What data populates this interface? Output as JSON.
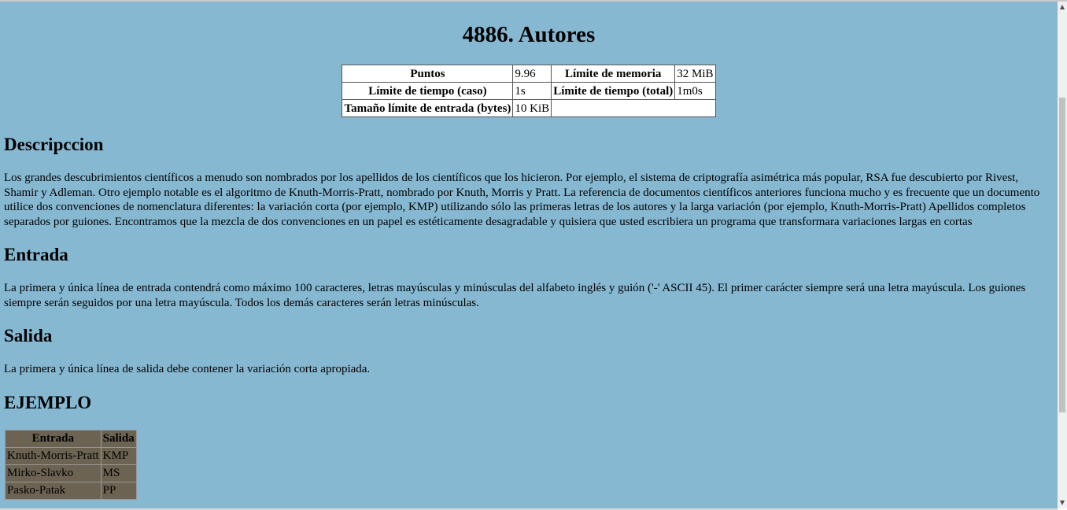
{
  "title": "4886. Autores",
  "info_table": {
    "puntos_label": "Puntos",
    "puntos_value": "9.96",
    "memoria_label": "Límite de memoria",
    "memoria_value": "32 MiB",
    "tiempo_caso_label": "Límite de tiempo (caso)",
    "tiempo_caso_value": "1s",
    "tiempo_total_label": "Límite de tiempo (total)",
    "tiempo_total_value": "1m0s",
    "entrada_label": "Tamaño límite de entrada (bytes)",
    "entrada_value": "10 KiB"
  },
  "sections": {
    "descripcion_heading": "Descripccion",
    "descripcion_text": "Los grandes descubrimientos científicos a menudo son nombrados por los apellidos de los científicos que los hicieron. Por ejemplo, el sistema de criptografía asimétrica más popular, RSA fue descubierto por Rivest, Shamir y Adleman. Otro ejemplo notable es el algoritmo de Knuth-Morris-Pratt, nombrado por Knuth, Morris y Pratt. La referencia de documentos científicos anteriores funciona mucho y es frecuente que un documento utilice dos convenciones de nomenclatura diferentes: la variación corta (por ejemplo, KMP) utilizando sólo las primeras letras de los autores y la larga variación (por ejemplo, Knuth-Morris-Pratt) Apellidos completos separados por guiones. Encontramos que la mezcla de dos convenciones en un papel es estéticamente desagradable y quisiera que usted escribiera un programa que transformara variaciones largas en cortas",
    "entrada_heading": "Entrada",
    "entrada_text": "La primera y única línea de entrada contendrá como máximo 100 caracteres, letras mayúsculas y minúsculas del alfabeto inglés y guión ('-' ASCII 45). El primer carácter siempre será una letra mayúscula. Los guiones siempre serán seguidos por una letra mayúscula. Todos los demás caracteres serán letras minúsculas.",
    "salida_heading": "Salida",
    "salida_text": "La primera y única línea de salida debe contener la variación corta apropiada.",
    "ejemplo_heading": "EJEMPLO"
  },
  "example_table": {
    "headers": [
      "Entrada",
      "Salida"
    ],
    "rows": [
      [
        "Knuth-Morris-Pratt",
        "KMP"
      ],
      [
        "Mirko-Slavko",
        "MS"
      ],
      [
        "Pasko-Patak",
        "PP"
      ]
    ]
  },
  "scrollbar": {
    "up_icon": "▲",
    "down_icon": "▼"
  }
}
